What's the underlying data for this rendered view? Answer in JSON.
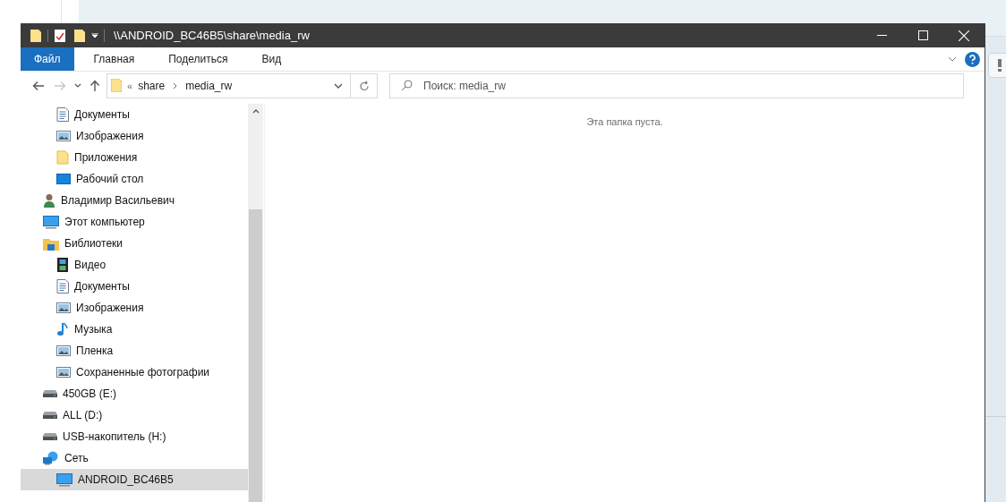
{
  "window": {
    "title": "\\\\ANDROID_BC46B5\\share\\media_rw"
  },
  "ribbon": {
    "tabs": [
      {
        "label": "Файл",
        "selected": true
      },
      {
        "label": "Главная",
        "selected": false
      },
      {
        "label": "Поделиться",
        "selected": false
      },
      {
        "label": "Вид",
        "selected": false
      }
    ]
  },
  "nav_buttons": [
    {
      "kind": "back",
      "disabled": false
    },
    {
      "kind": "forward",
      "disabled": true
    },
    {
      "kind": "recent",
      "disabled": false
    },
    {
      "kind": "up",
      "disabled": false
    }
  ],
  "address": {
    "overflow": "«",
    "path": [
      "share",
      "media_rw"
    ]
  },
  "search": {
    "placeholder": "Поиск: media_rw"
  },
  "nav_pane": {
    "continued_children": [
      {
        "label": "Документы",
        "kind": "documents",
        "selected": false
      },
      {
        "label": "Изображения",
        "kind": "pictures",
        "selected": false
      },
      {
        "label": "Приложения",
        "kind": "folder",
        "selected": false
      },
      {
        "label": "Рабочий стол",
        "kind": "desktop",
        "selected": false
      }
    ],
    "items": [
      {
        "label": "Владимир Васильевич",
        "kind": "user",
        "selected": false
      },
      {
        "label": "Этот компьютер",
        "kind": "computer",
        "selected": false
      },
      {
        "label": "Библиотеки",
        "kind": "libraries",
        "selected": false,
        "children": [
          {
            "label": "Видео",
            "kind": "video",
            "selected": false
          },
          {
            "label": "Документы",
            "kind": "documents",
            "selected": false
          },
          {
            "label": "Изображения",
            "kind": "pictures",
            "selected": false
          },
          {
            "label": "Музыка",
            "kind": "music",
            "selected": false
          },
          {
            "label": "Пленка",
            "kind": "pictures",
            "selected": false
          },
          {
            "label": "Сохраненные фотографии",
            "kind": "pictures",
            "selected": false
          }
        ]
      },
      {
        "label": "450GB (E:)",
        "kind": "drive",
        "selected": false
      },
      {
        "label": "ALL (D:)",
        "kind": "drive",
        "selected": false
      },
      {
        "label": "USB-накопитель (H:)",
        "kind": "drive",
        "selected": false
      },
      {
        "label": "Сеть",
        "kind": "network",
        "selected": false,
        "children": [
          {
            "label": "ANDROID_BC46B5",
            "kind": "computer",
            "selected": true
          }
        ]
      }
    ]
  },
  "content": {
    "empty_message": "Эта папка пуста."
  }
}
